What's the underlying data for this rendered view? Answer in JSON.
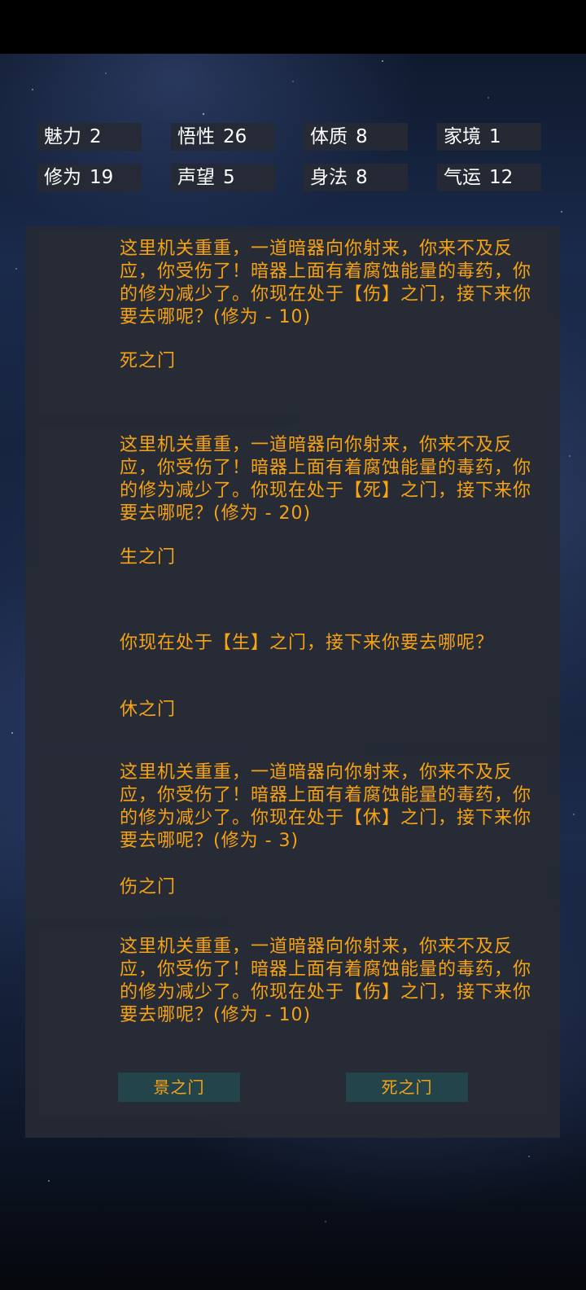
{
  "stats": [
    {
      "label": "魅力",
      "value": "2"
    },
    {
      "label": "悟性",
      "value": "26"
    },
    {
      "label": "体质",
      "value": "8"
    },
    {
      "label": "家境",
      "value": "1"
    },
    {
      "label": "修为",
      "value": "19"
    },
    {
      "label": "声望",
      "value": "5"
    },
    {
      "label": "身法",
      "value": "8"
    },
    {
      "label": "气运",
      "value": "12"
    }
  ],
  "log": [
    {
      "text": "这里机关重重，一道暗器向你射来，你来不及反应，你受伤了！暗器上面有着腐蚀能量的毒药，你的修为减少了。你现在处于【伤】之门，接下来你要去哪呢？(修为 - 10)",
      "choice": "死之门"
    },
    {
      "text": "这里机关重重，一道暗器向你射来，你来不及反应，你受伤了！暗器上面有着腐蚀能量的毒药，你的修为减少了。你现在处于【死】之门，接下来你要去哪呢？(修为 - 20)",
      "choice": "生之门"
    },
    {
      "text": "你现在处于【生】之门，接下来你要去哪呢？",
      "choice": "休之门"
    },
    {
      "text": "这里机关重重，一道暗器向你射来，你来不及反应，你受伤了！暗器上面有着腐蚀能量的毒药，你的修为减少了。你现在处于【休】之门，接下来你要去哪呢？(修为 - 3)",
      "choice": "伤之门"
    }
  ],
  "current": {
    "text": "这里机关重重，一道暗器向你射来，你来不及反应，你受伤了！暗器上面有着腐蚀能量的毒药，你的修为减少了。你现在处于【伤】之门，接下来你要去哪呢？(修为 - 10)",
    "options": [
      "景之门",
      "死之门"
    ]
  }
}
